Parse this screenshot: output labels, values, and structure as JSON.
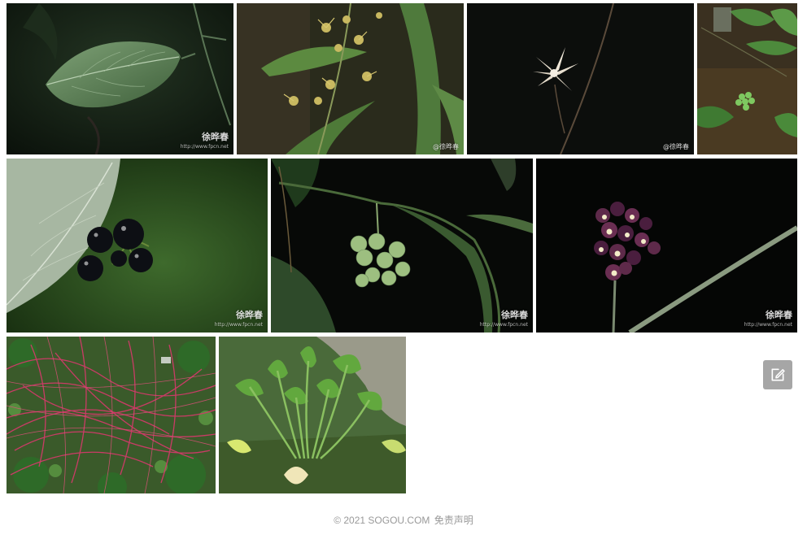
{
  "gallery": {
    "images": [
      {
        "subject": "dark green ovate leaf on vine",
        "watermark_main": "徐晔春",
        "watermark_url": "http://www.fpcn.net"
      },
      {
        "subject": "orchid raceme with small yellowish flowers",
        "watermark_main": "@徐晔春",
        "watermark_url": ""
      },
      {
        "subject": "single white star-shaped flower",
        "watermark_main": "@徐晔春",
        "watermark_url": ""
      },
      {
        "subject": "climbing plant with green berries",
        "watermark_main": "",
        "watermark_url": ""
      },
      {
        "subject": "black berries under large leaf",
        "watermark_main": "徐晔春",
        "watermark_url": "http://www.fpcn.net"
      },
      {
        "subject": "cluster of pale green berries",
        "watermark_main": "徐晔春",
        "watermark_url": "http://www.fpcn.net"
      },
      {
        "subject": "purple orchid flower cluster",
        "watermark_main": "徐晔春",
        "watermark_url": "http://www.fpcn.net"
      },
      {
        "subject": "red dodder vines over shrubs",
        "watermark_main": "",
        "watermark_url": ""
      },
      {
        "subject": "aquatic plant with broad leaves in pond",
        "watermark_main": "",
        "watermark_url": ""
      }
    ]
  },
  "feedback": {
    "icon": "edit-icon"
  },
  "footer": {
    "copyright": "© 2021 SOGOU.COM",
    "disclaimer": "免责声明"
  },
  "colors": {
    "footer_text": "#999999",
    "feedback_bg": "#a6a6a6",
    "page_bg": "#ffffff"
  }
}
